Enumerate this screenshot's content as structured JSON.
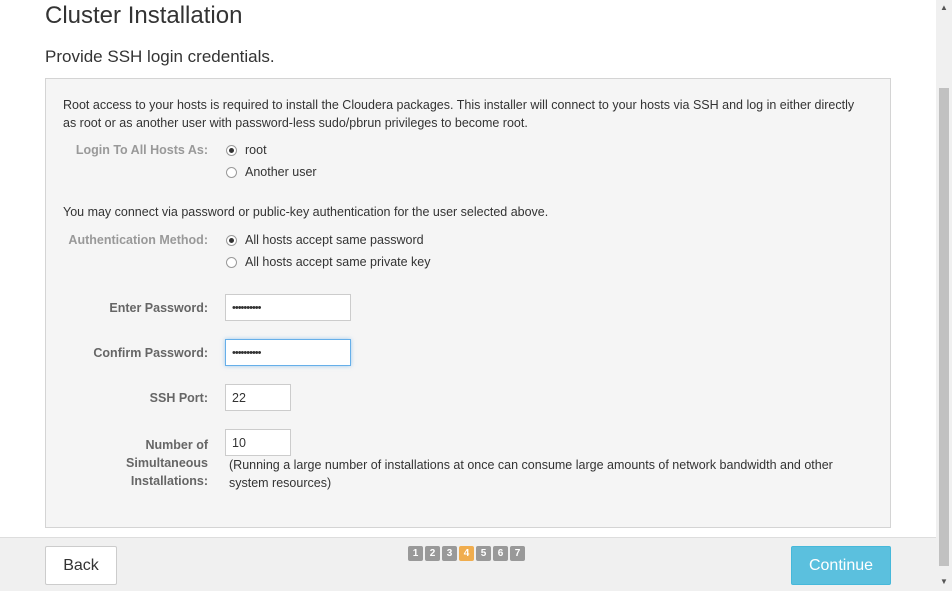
{
  "header": {
    "title": "Cluster Installation",
    "subtitle": "Provide SSH login credentials."
  },
  "intro": {
    "text": "Root access to your hosts is required to install the Cloudera packages. This installer will connect to your hosts via SSH and log in either directly as root or as another user with password-less sudo/pbrun privileges to become root.",
    "auth_text": "You may connect via password or public-key authentication for the user selected above."
  },
  "login": {
    "label": "Login To All Hosts As:",
    "options": [
      "root",
      "Another user"
    ],
    "selected": "root"
  },
  "auth": {
    "label": "Authentication Method:",
    "options": [
      "All hosts accept same password",
      "All hosts accept same private key"
    ],
    "selected": "All hosts accept same password"
  },
  "password": {
    "label": "Enter Password:",
    "value": "••••••••••"
  },
  "confirm_password": {
    "label": "Confirm Password:",
    "value": "••••••••••"
  },
  "ssh_port": {
    "label": "SSH Port:",
    "value": "22"
  },
  "simultaneous": {
    "label_line1": "Number of",
    "label_line2": "Simultaneous",
    "label_line3": "Installations:",
    "value": "10",
    "help": "(Running a large number of installations at once can consume large amounts of network bandwidth and other system resources)"
  },
  "footer": {
    "back_label": "Back",
    "continue_label": "Continue",
    "steps": [
      "1",
      "2",
      "3",
      "4",
      "5",
      "6",
      "7"
    ],
    "current_step": "4"
  },
  "colors": {
    "accent": "#5bc0de",
    "active_step": "#f0ad4e",
    "inactive_step": "#999999"
  }
}
